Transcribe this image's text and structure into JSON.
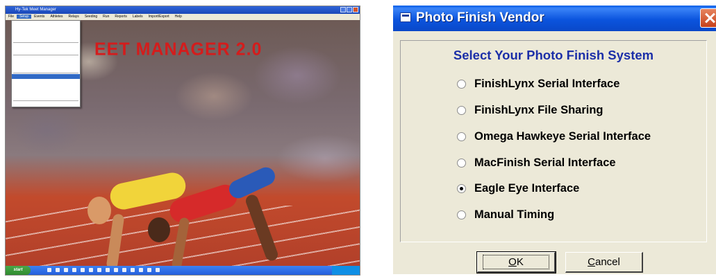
{
  "left_screenshot": {
    "window_title": "Hy-Tek Meet Manager",
    "menu_items": [
      "File",
      "Setup",
      "Events",
      "Athletes",
      "Relays",
      "Seeding",
      "Run",
      "Reports",
      "Labels",
      "Import/Export",
      "Help"
    ],
    "active_menu": "Setup",
    "file_menu_items": [
      "",
      "",
      "",
      "",
      "",
      "",
      "",
      "",
      "",
      "",
      "",
      "",
      "",
      "",
      "",
      "",
      "",
      "",
      "",
      "",
      "",
      "",
      ""
    ],
    "splash_title": "EET MANAGER 2.0",
    "start_label": "start"
  },
  "dialog": {
    "title": "Photo Finish Vendor",
    "heading": "Select Your Photo Finish System",
    "options": [
      {
        "label": "FinishLynx Serial Interface",
        "checked": false
      },
      {
        "label": "FinishLynx File Sharing",
        "checked": false
      },
      {
        "label": "Omega Hawkeye Serial Interface",
        "checked": false
      },
      {
        "label": "MacFinish Serial Interface",
        "checked": false
      },
      {
        "label": "Eagle Eye Interface",
        "checked": true
      },
      {
        "label": "Manual Timing",
        "checked": false
      }
    ],
    "ok_label_underlined": "O",
    "ok_label_rest": "K",
    "cancel_label_underlined": "C",
    "cancel_label_rest": "ancel"
  },
  "colors": {
    "title_bar_blue": "#0b54de",
    "heading_blue": "#1c2fa8",
    "dialog_bg": "#ece9d8",
    "splash_red": "#d41c1c"
  },
  "icons": [
    "app-window-icon",
    "close-icon",
    "radio-button-icon"
  ]
}
